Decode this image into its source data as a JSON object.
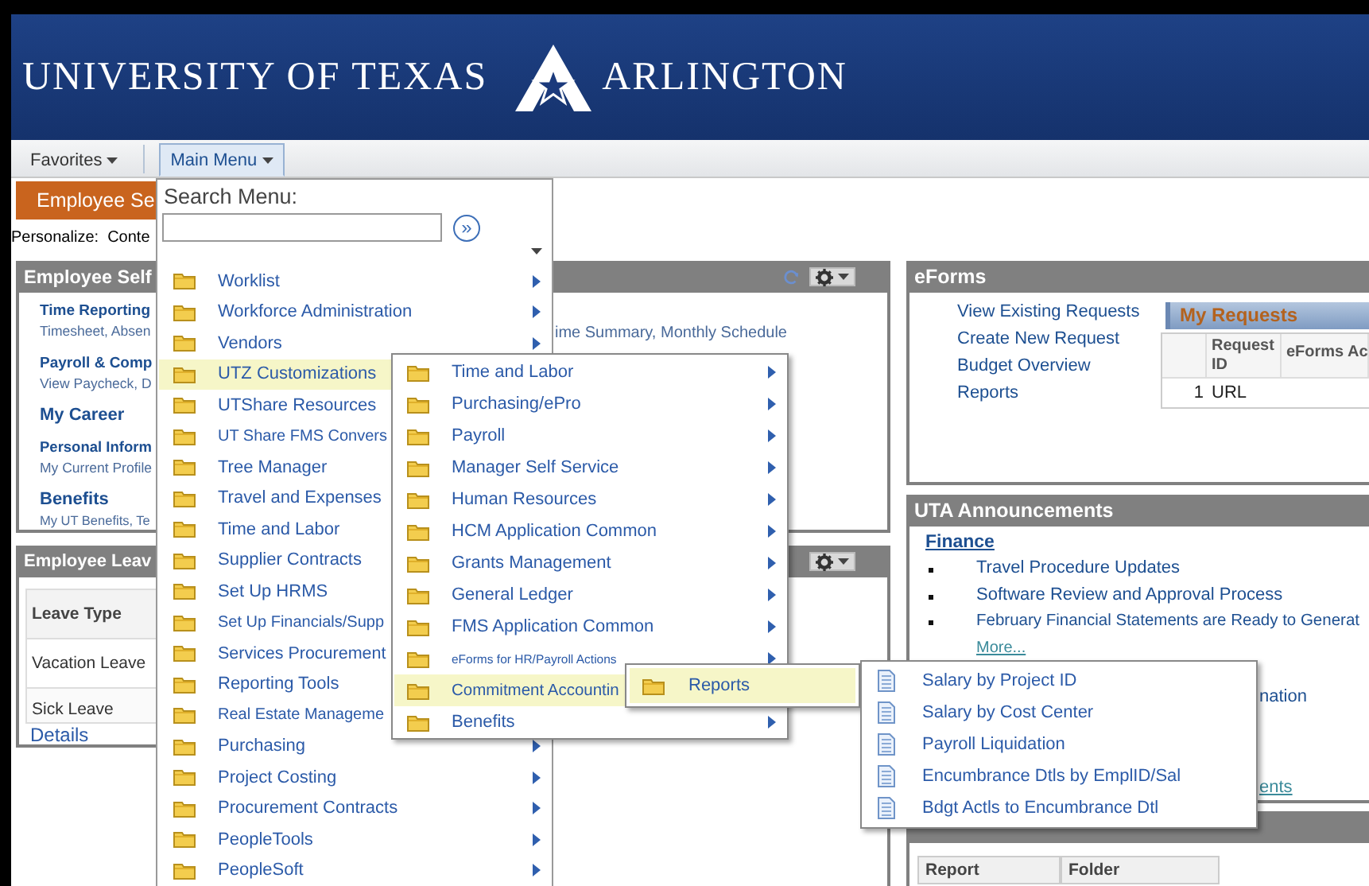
{
  "header": {
    "left": "UNIVERSITY OF TEXAS",
    "right": "ARLINGTON"
  },
  "nav": [
    {
      "label": "Favorites",
      "selected": false
    },
    {
      "label": "Main Menu",
      "selected": true
    }
  ],
  "page_tab": "Employee Se",
  "personalize": "Personalize:  Conte",
  "employee_self": {
    "title": "Employee Self",
    "items": [
      {
        "title": "Time Reporting",
        "subtitle": "Timesheet, Absen"
      },
      {
        "title": "Payroll & Comp",
        "subtitle": "View Paycheck, D"
      },
      {
        "title": "My Career"
      },
      {
        "title": "Personal Inform",
        "subtitle": "My Current Profile"
      },
      {
        "title": "Benefits",
        "subtitle": "My UT Benefits, Te"
      }
    ]
  },
  "employee_leave": {
    "title": "Employee Leav",
    "columns": [
      "Leave Type"
    ],
    "rows": [
      "Vacation Leave",
      "Sick Leave"
    ],
    "link": "Details"
  },
  "schedule_panel": {
    "text": "ime Summary, Monthly Schedule"
  },
  "eforms": {
    "title": "eForms",
    "links": [
      "View Existing Requests",
      "Create New Request",
      "Budget Overview",
      "Reports"
    ],
    "requests": {
      "title": "My Requests",
      "columns": [
        "Request ID",
        "eForms Ac"
      ],
      "rows": [
        {
          "number": "1",
          "id": "URL"
        }
      ]
    }
  },
  "announcements": {
    "title": "UTA Announcements",
    "section": "Finance",
    "items": [
      "Travel Procedure Updates",
      "Software Review and Approval Process",
      "February Financial Statements are Ready to Generat"
    ],
    "more": "More...",
    "partial_text": "nation",
    "partial_link": "ents"
  },
  "my_reports": {
    "columns": [
      "Report",
      "Folder"
    ]
  },
  "main_menu": {
    "search_label": "Search Menu:",
    "go_button": "»",
    "items": [
      {
        "label": "Worklist",
        "selected": false
      },
      {
        "label": "Workforce Administration",
        "selected": false
      },
      {
        "label": "Vendors",
        "selected": false
      },
      {
        "label": "UTZ Customizations",
        "selected": true
      },
      {
        "label": "UTShare Resources",
        "selected": false
      },
      {
        "label": "UT Share FMS Convers",
        "selected": false
      },
      {
        "label": "Tree Manager",
        "selected": false
      },
      {
        "label": "Travel and Expenses",
        "selected": false
      },
      {
        "label": "Time and Labor",
        "selected": false
      },
      {
        "label": "Supplier Contracts",
        "selected": false
      },
      {
        "label": "Set Up HRMS",
        "selected": false
      },
      {
        "label": "Set Up Financials/Supp",
        "selected": false
      },
      {
        "label": "Services Procurement",
        "selected": false
      },
      {
        "label": "Reporting Tools",
        "selected": false
      },
      {
        "label": "Real Estate Manageme",
        "selected": false
      },
      {
        "label": "Purchasing",
        "selected": false
      },
      {
        "label": "Project Costing",
        "selected": false
      },
      {
        "label": "Procurement Contracts",
        "selected": false
      },
      {
        "label": "PeopleTools",
        "selected": false
      },
      {
        "label": "PeopleSoft",
        "selected": false
      }
    ]
  },
  "submenu": {
    "items": [
      {
        "label": "Time and Labor",
        "selected": false
      },
      {
        "label": "Purchasing/ePro",
        "selected": false
      },
      {
        "label": "Payroll",
        "selected": false
      },
      {
        "label": "Manager Self Service",
        "selected": false
      },
      {
        "label": "Human Resources",
        "selected": false
      },
      {
        "label": "HCM Application Common",
        "selected": false
      },
      {
        "label": "Grants Management",
        "selected": false
      },
      {
        "label": "General Ledger",
        "selected": false
      },
      {
        "label": "FMS Application Common",
        "selected": false
      },
      {
        "label": "eForms for HR/Payroll Actions",
        "selected": false
      },
      {
        "label": "Commitment Accountin",
        "selected": true
      },
      {
        "label": "Benefits",
        "selected": false
      }
    ]
  },
  "reports_menu": {
    "items": [
      {
        "label": "Reports",
        "selected": true
      }
    ]
  },
  "report_list": {
    "items": [
      "Salary by Project ID",
      "Salary by Cost Center",
      "Payroll Liquidation",
      "Encumbrance Dtls by EmplID/Sal",
      "Bdgt Actls to Encumbrance Dtl"
    ]
  }
}
